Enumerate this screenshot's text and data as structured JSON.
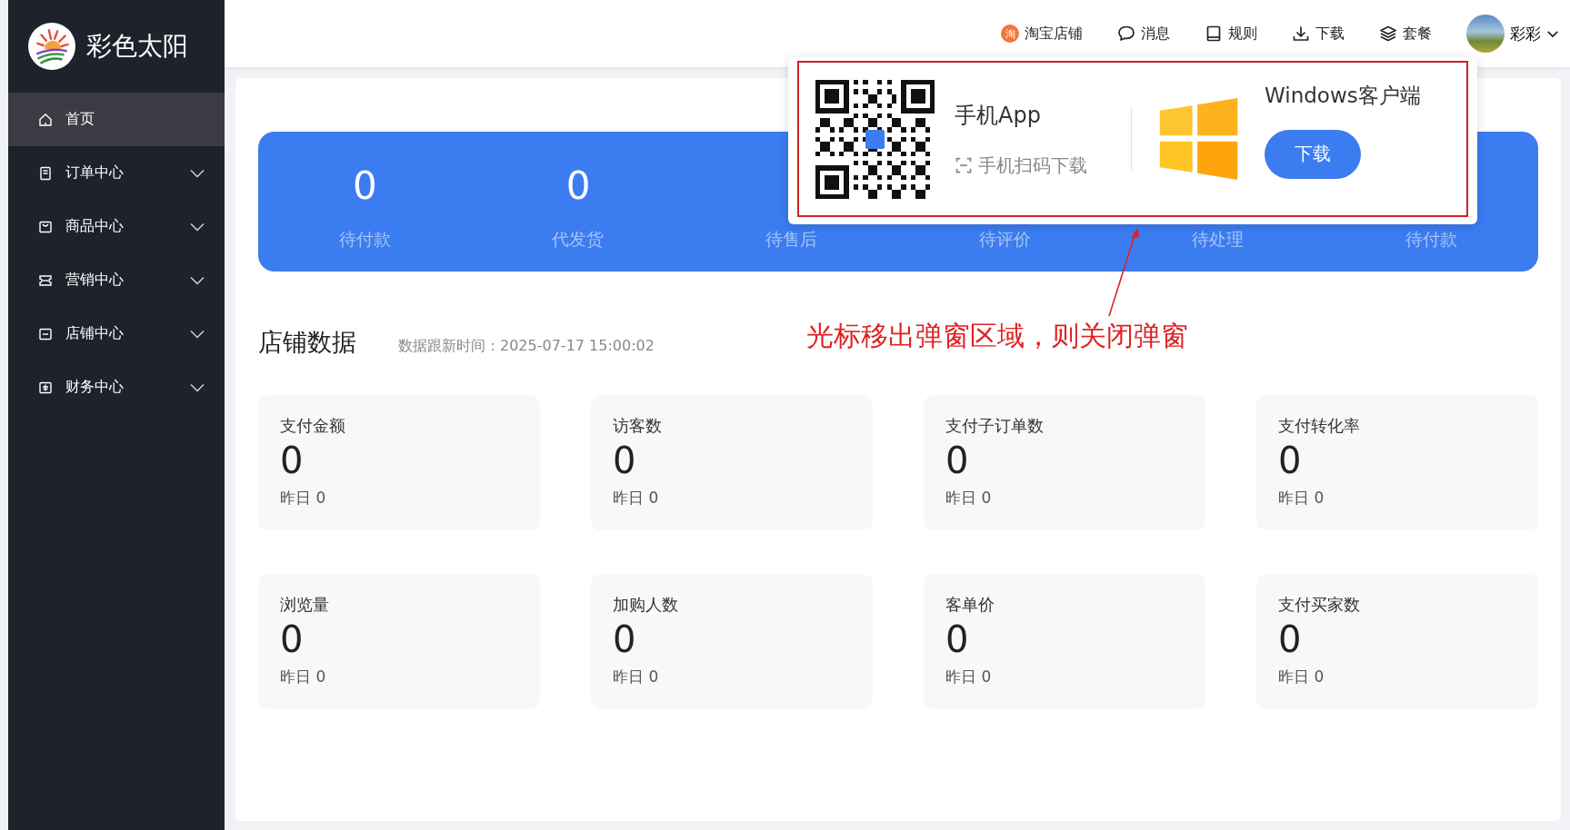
{
  "brand": {
    "name": "彩色太阳"
  },
  "sidebar": {
    "items": [
      {
        "kind": "home",
        "label": "首页",
        "selected": true,
        "has_submenu": false
      },
      {
        "kind": "order",
        "label": "订单中心",
        "selected": false,
        "has_submenu": true
      },
      {
        "kind": "goods",
        "label": "商品中心",
        "selected": false,
        "has_submenu": true
      },
      {
        "kind": "ticket",
        "label": "营销中心",
        "selected": false,
        "has_submenu": true
      },
      {
        "kind": "store",
        "label": "店铺中心",
        "selected": false,
        "has_submenu": true
      },
      {
        "kind": "finance",
        "label": "财务中心",
        "selected": false,
        "has_submenu": true
      }
    ]
  },
  "header": {
    "links": [
      {
        "kind": "taobao",
        "label": "淘宝店铺",
        "badge": "淘"
      },
      {
        "kind": "message",
        "label": "消息"
      },
      {
        "kind": "rules",
        "label": "规则"
      },
      {
        "kind": "download",
        "label": "下载"
      },
      {
        "kind": "package",
        "label": "套餐"
      }
    ],
    "user": {
      "name": "彩彩"
    }
  },
  "order_stats": [
    {
      "value": "0",
      "label": "待付款"
    },
    {
      "value": "0",
      "label": "代发货"
    },
    {
      "label": "待售后"
    },
    {
      "label": "待评价"
    },
    {
      "label": "待处理"
    },
    {
      "label": "待付款"
    }
  ],
  "store_data": {
    "title": "店铺数据",
    "updated": "数据跟新时间：2025-07-17 15:00:02",
    "metrics": [
      {
        "label": "支付金额",
        "value": "0",
        "yesterday": "昨日 0"
      },
      {
        "label": "访客数",
        "value": "0",
        "yesterday": "昨日 0"
      },
      {
        "label": "支付子订单数",
        "value": "0",
        "yesterday": "昨日 0"
      },
      {
        "label": "支付转化率",
        "value": "0",
        "yesterday": "昨日 0"
      },
      {
        "label": "浏览量",
        "value": "0",
        "yesterday": "昨日 0"
      },
      {
        "label": "加购人数",
        "value": "0",
        "yesterday": "昨日 0"
      },
      {
        "label": "客单价",
        "value": "0",
        "yesterday": "昨日 0"
      },
      {
        "label": "支付买家数",
        "value": "0",
        "yesterday": "昨日 0"
      }
    ]
  },
  "download_popup": {
    "app_title": "手机App",
    "app_hint": "手机扫码下载",
    "windows_title": "Windows客户端",
    "button": "下载"
  },
  "annotation": {
    "text": "光标移出弹窗区域，则关闭弹窗"
  }
}
